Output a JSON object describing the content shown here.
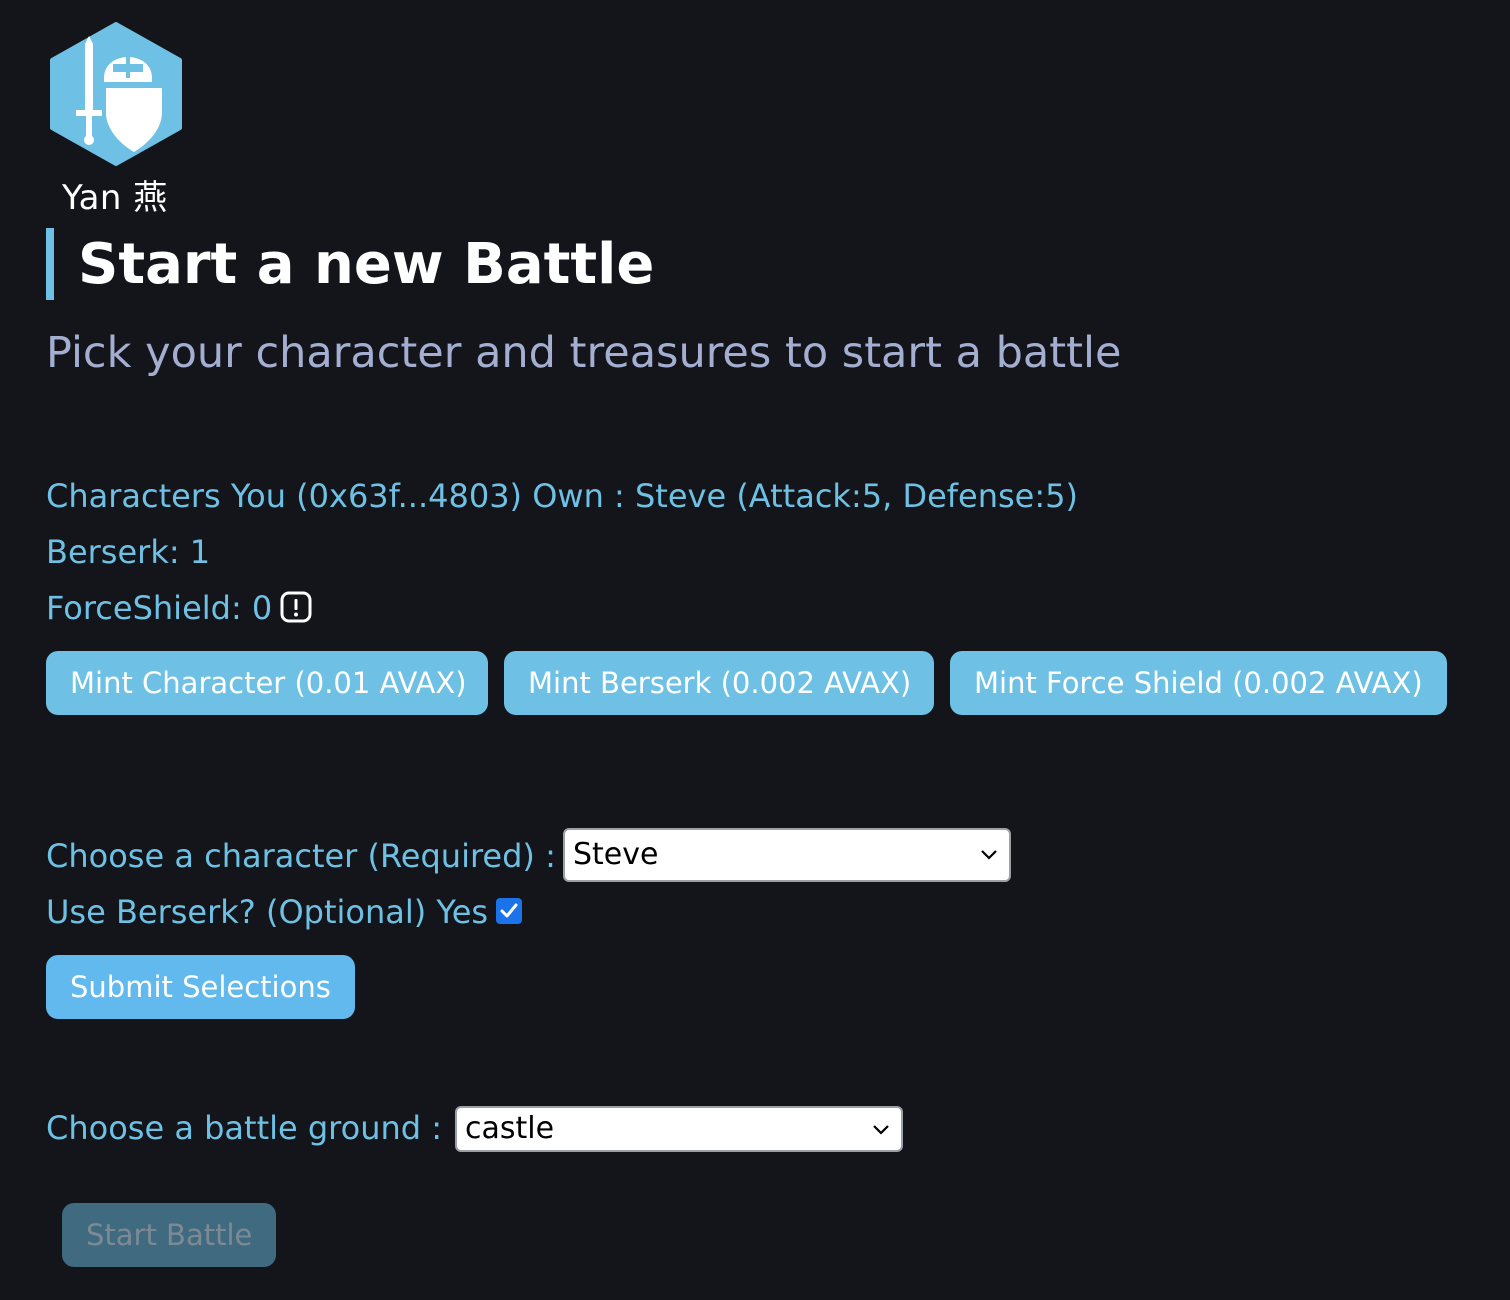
{
  "brand": {
    "logo_icon": "knight-helmet-sword-shield-icon",
    "name": "Yan 燕",
    "colors": {
      "hex": "#6ec1e4",
      "glyph": "#ffffff"
    }
  },
  "header": {
    "title": "Start a new Battle",
    "subtitle": "Pick your character and treasures to start a battle"
  },
  "inventory": {
    "characters_line": "Characters You (0x63f...4803) Own : Steve (Attack:5, Defense:5)",
    "berserk_line": "Berserk: 1",
    "forceshield_line": "ForceShield: 0",
    "alert_icon": "exclamation-square-icon"
  },
  "mint": {
    "character_label": "Mint Character (0.01 AVAX)",
    "berserk_label": "Mint Berserk (0.002 AVAX)",
    "force_shield_label": "Mint Force Shield (0.002 AVAX)"
  },
  "selection": {
    "character_label": "Choose a character (Required) :",
    "character_value": "Steve",
    "berserk_label": "Use Berserk? (Optional) Yes",
    "berserk_checked": true,
    "submit_label": "Submit Selections"
  },
  "battle": {
    "ground_label": "Choose a battle ground :",
    "ground_value": "castle",
    "start_label": "Start Battle",
    "start_disabled": true
  },
  "theme": {
    "background": "#13151a",
    "accent": "#6ec1e4",
    "subtitle_color": "#a3aed0",
    "disabled_button": "#3f6a80"
  }
}
